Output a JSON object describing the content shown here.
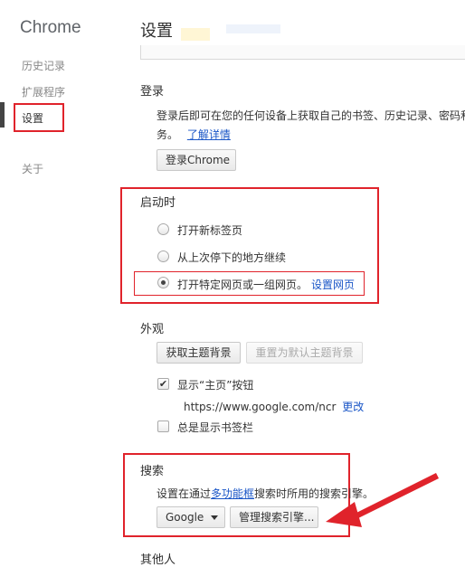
{
  "sidebar": {
    "brand": "Chrome",
    "items": [
      {
        "label": "历史记录"
      },
      {
        "label": "扩展程序"
      },
      {
        "label": "设置"
      },
      {
        "label": "关于"
      }
    ]
  },
  "page": {
    "title": "设置"
  },
  "signin": {
    "title": "登录",
    "description": "登录后即可在您的任何设备上获取自己的书签、历史记录、密码和其他设置。此外，您还会自动登录到您的Google服",
    "description_tail": "务。",
    "learn_more": "了解详情",
    "button": "登录Chrome"
  },
  "startup": {
    "title": "启动时",
    "options": [
      {
        "label": "打开新标签页",
        "checked": false
      },
      {
        "label": "从上次停下的地方继续",
        "checked": false
      },
      {
        "label": "打开特定网页或一组网页。",
        "checked": true
      }
    ],
    "set_pages_link": "设置网页"
  },
  "appearance": {
    "title": "外观",
    "get_themes": "获取主题背景",
    "reset_theme": "重置为默认主题背景",
    "show_home": "显示“主页”按钮",
    "home_url": "https://www.google.com/ncr",
    "change_link": "更改",
    "show_bookmarks": "总是显示书签栏"
  },
  "search": {
    "title": "搜索",
    "desc_prefix": "设置在通过",
    "omnibox_link": "多功能框",
    "desc_suffix": "搜索时所用的搜索引擎。",
    "engine": "Google",
    "manage": "管理搜索引擎..."
  },
  "people": {
    "title": "其他人"
  },
  "colors": {
    "highlight": "#e0232b",
    "link": "#1a56c7"
  }
}
